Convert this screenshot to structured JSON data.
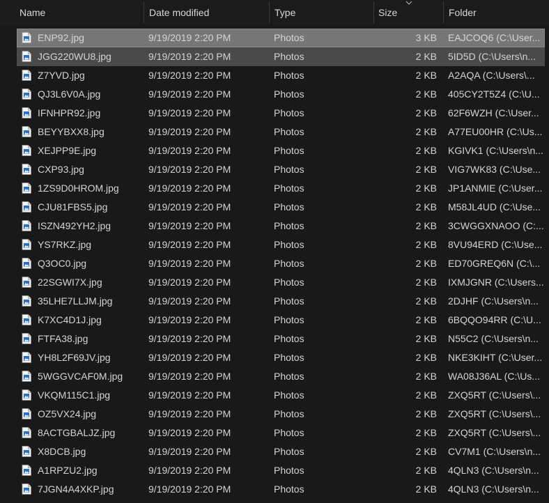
{
  "columns": {
    "name": "Name",
    "date_modified": "Date modified",
    "type": "Type",
    "size": "Size",
    "folder": "Folder"
  },
  "sort": {
    "column": "Size",
    "direction": "descending"
  },
  "colors": {
    "background": "#191919",
    "selected_primary": "#777777",
    "selected_secondary": "#4a4a4a",
    "icon_blue": "#2b6fc2"
  },
  "icon": "photo-file-icon",
  "files": [
    {
      "name": "ENP92.jpg",
      "date": "9/19/2019 2:20 PM",
      "type": "Photos",
      "size": "3 KB",
      "folder": "EAJCOQ6 (C:\\User..."
    },
    {
      "name": "JGG220WU8.jpg",
      "date": "9/19/2019 2:20 PM",
      "type": "Photos",
      "size": "2 KB",
      "folder": "5ID5D (C:\\Users\\n..."
    },
    {
      "name": "Z7YVD.jpg",
      "date": "9/19/2019 2:20 PM",
      "type": "Photos",
      "size": "2 KB",
      "folder": "A2AQA (C:\\Users\\..."
    },
    {
      "name": "QJ3L6V0A.jpg",
      "date": "9/19/2019 2:20 PM",
      "type": "Photos",
      "size": "2 KB",
      "folder": "405CY2T5Z4 (C:\\U..."
    },
    {
      "name": "IFNHPR92.jpg",
      "date": "9/19/2019 2:20 PM",
      "type": "Photos",
      "size": "2 KB",
      "folder": "62F6WZH (C:\\User..."
    },
    {
      "name": "BEYYBXX8.jpg",
      "date": "9/19/2019 2:20 PM",
      "type": "Photos",
      "size": "2 KB",
      "folder": "A77EU00HR (C:\\Us..."
    },
    {
      "name": "XEJPP9E.jpg",
      "date": "9/19/2019 2:20 PM",
      "type": "Photos",
      "size": "2 KB",
      "folder": "KGIVK1 (C:\\Users\\n..."
    },
    {
      "name": "CXP93.jpg",
      "date": "9/19/2019 2:20 PM",
      "type": "Photos",
      "size": "2 KB",
      "folder": "VIG7WK83 (C:\\Use..."
    },
    {
      "name": "1ZS9D0HROM.jpg",
      "date": "9/19/2019 2:20 PM",
      "type": "Photos",
      "size": "2 KB",
      "folder": "JP1ANMIE (C:\\User..."
    },
    {
      "name": "CJU81FBS5.jpg",
      "date": "9/19/2019 2:20 PM",
      "type": "Photos",
      "size": "2 KB",
      "folder": "M58JL4UD (C:\\Use..."
    },
    {
      "name": "ISZN492YH2.jpg",
      "date": "9/19/2019 2:20 PM",
      "type": "Photos",
      "size": "2 KB",
      "folder": "3CWGGXNAOO (C:..."
    },
    {
      "name": "YS7RKZ.jpg",
      "date": "9/19/2019 2:20 PM",
      "type": "Photos",
      "size": "2 KB",
      "folder": "8VU94ERD (C:\\Use..."
    },
    {
      "name": "Q3OC0.jpg",
      "date": "9/19/2019 2:20 PM",
      "type": "Photos",
      "size": "2 KB",
      "folder": "ED70GREQ6N (C:\\..."
    },
    {
      "name": "22SGWI7X.jpg",
      "date": "9/19/2019 2:20 PM",
      "type": "Photos",
      "size": "2 KB",
      "folder": "IXMJGNR (C:\\Users..."
    },
    {
      "name": "35LHE7LLJM.jpg",
      "date": "9/19/2019 2:20 PM",
      "type": "Photos",
      "size": "2 KB",
      "folder": "2DJHF (C:\\Users\\n..."
    },
    {
      "name": "K7XC4D1J.jpg",
      "date": "9/19/2019 2:20 PM",
      "type": "Photos",
      "size": "2 KB",
      "folder": "6BQQO94RR (C:\\U..."
    },
    {
      "name": "FTFA38.jpg",
      "date": "9/19/2019 2:20 PM",
      "type": "Photos",
      "size": "2 KB",
      "folder": "N55C2 (C:\\Users\\n..."
    },
    {
      "name": "YH8L2F69JV.jpg",
      "date": "9/19/2019 2:20 PM",
      "type": "Photos",
      "size": "2 KB",
      "folder": "NKE3KIHT (C:\\User..."
    },
    {
      "name": "5WGGVCAF0M.jpg",
      "date": "9/19/2019 2:20 PM",
      "type": "Photos",
      "size": "2 KB",
      "folder": "WA08J36AL (C:\\Us..."
    },
    {
      "name": "VKQM115C1.jpg",
      "date": "9/19/2019 2:20 PM",
      "type": "Photos",
      "size": "2 KB",
      "folder": "ZXQ5RT (C:\\Users\\..."
    },
    {
      "name": "OZ5VX24.jpg",
      "date": "9/19/2019 2:20 PM",
      "type": "Photos",
      "size": "2 KB",
      "folder": "ZXQ5RT (C:\\Users\\..."
    },
    {
      "name": "8ACTGBALJZ.jpg",
      "date": "9/19/2019 2:20 PM",
      "type": "Photos",
      "size": "2 KB",
      "folder": "ZXQ5RT (C:\\Users\\..."
    },
    {
      "name": "X8DCB.jpg",
      "date": "9/19/2019 2:20 PM",
      "type": "Photos",
      "size": "2 KB",
      "folder": "CV7M1 (C:\\Users\\n..."
    },
    {
      "name": "A1RPZU2.jpg",
      "date": "9/19/2019 2:20 PM",
      "type": "Photos",
      "size": "2 KB",
      "folder": "4QLN3 (C:\\Users\\n..."
    },
    {
      "name": "7JGN4A4XKP.jpg",
      "date": "9/19/2019 2:20 PM",
      "type": "Photos",
      "size": "2 KB",
      "folder": "4QLN3 (C:\\Users\\n..."
    }
  ],
  "selection": {
    "primary": 0,
    "secondary": 1
  }
}
